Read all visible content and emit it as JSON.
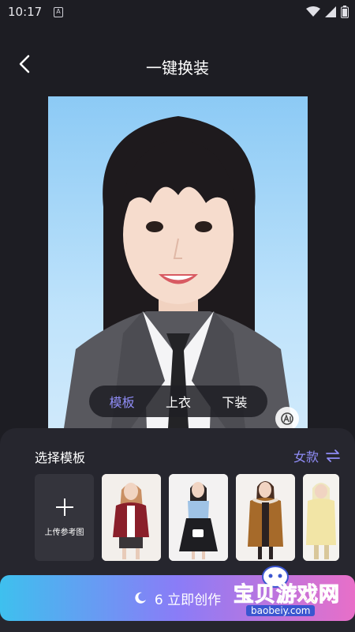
{
  "status_bar": {
    "time": "10:17",
    "notification_letter": "A"
  },
  "app_bar": {
    "title": "一键换装",
    "back_icon": "chevron-left-icon"
  },
  "photo": {
    "subject": "portrait-photo"
  },
  "segments": {
    "items": [
      {
        "label": "模板",
        "active": true
      },
      {
        "label": "上衣",
        "active": false
      },
      {
        "label": "下装",
        "active": false
      }
    ]
  },
  "sheet": {
    "title": "选择模板",
    "gender_label": "女款",
    "upload_label": "上传参考图",
    "templates": [
      "burgundy-cardigan-outfit",
      "blue-top-black-skirt-outfit",
      "brown-parka-outfit",
      "yellow-puffer-outfit"
    ]
  },
  "cta": {
    "label": "6 立即创作",
    "icon": "moon-icon"
  },
  "watermark": {
    "text": "宝贝游戏网",
    "url": "baobeiy.com"
  },
  "colors": {
    "background": "#1d1d23",
    "sheet": "#26262e",
    "accent": "#8f8cf6"
  }
}
